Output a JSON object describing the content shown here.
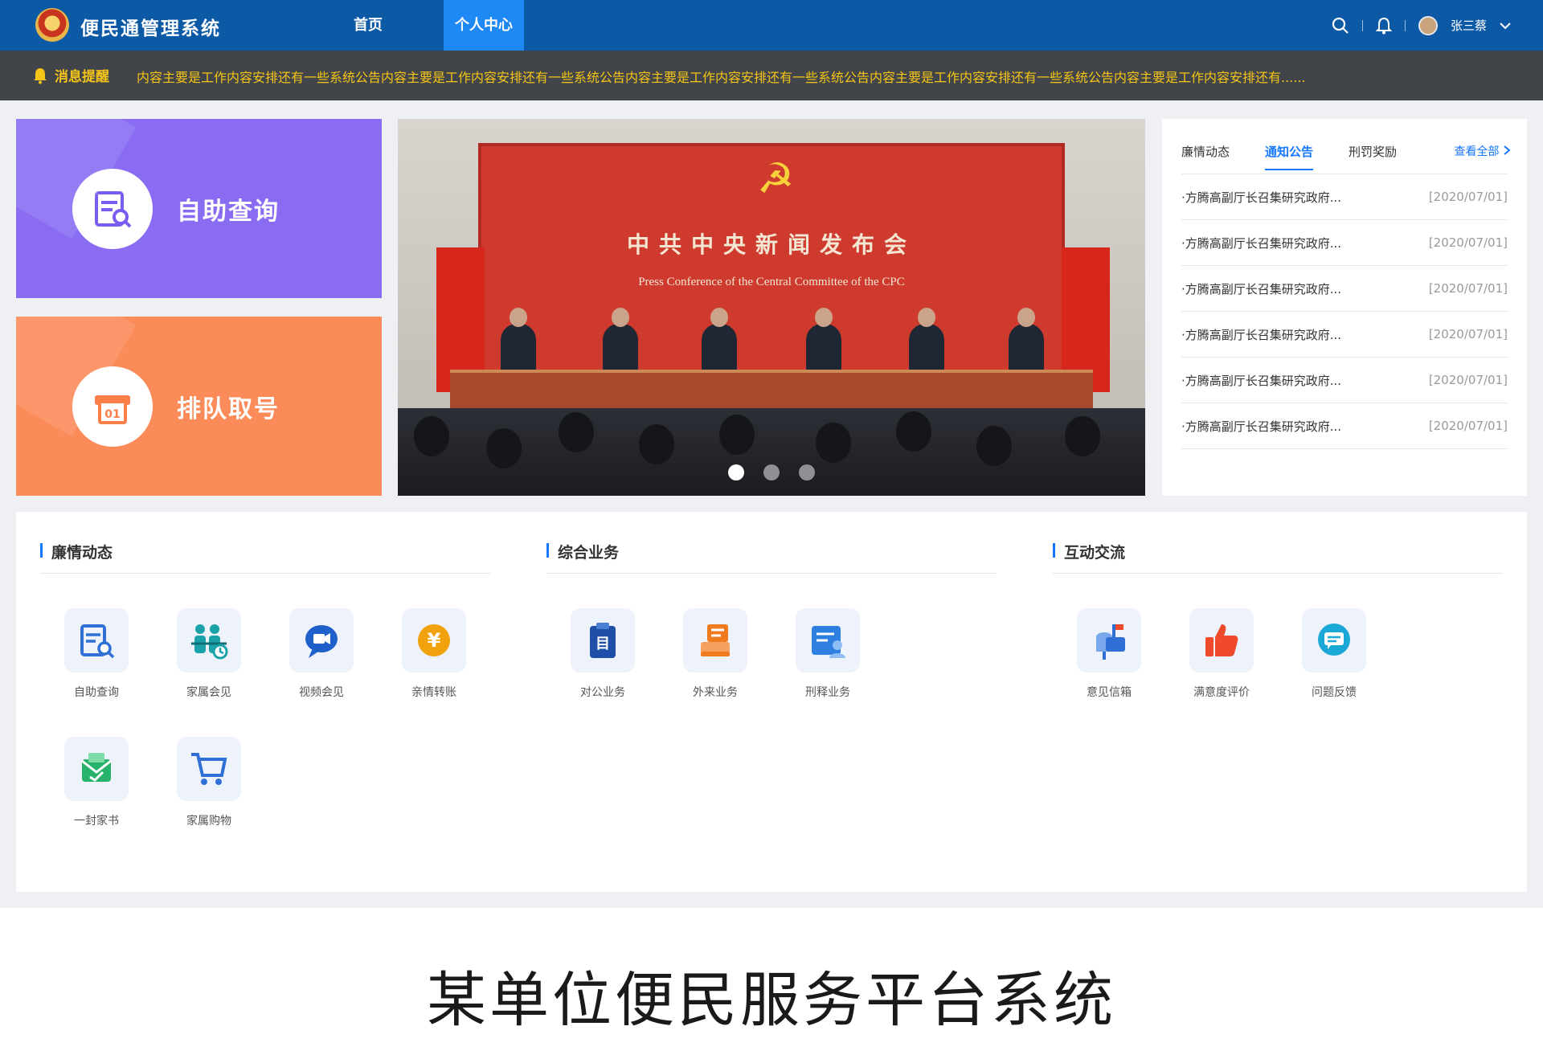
{
  "header": {
    "app_title": "便民通管理系统",
    "nav": {
      "home": "首页",
      "personal": "个人中心"
    },
    "user_name": "张三蔡"
  },
  "notice_bar": {
    "label": "消息提醒",
    "text": "内容主要是工作内容安排还有一些系统公告内容主要是工作内容安排还有一些系统公告内容主要是工作内容安排还有一些系统公告内容主要是工作内容安排还有一些系统公告内容主要是工作内容安排还有......"
  },
  "tiles": {
    "self_query": "自助查询",
    "queue": "排队取号"
  },
  "banner": {
    "title_cn": "中共中央新闻发布会",
    "title_en": "Press Conference of the Central Committee of the CPC",
    "slide_count": 3,
    "active_slide": 1
  },
  "notice_panel": {
    "tabs": [
      "廉情动态",
      "通知公告",
      "刑罚奖励"
    ],
    "active_tab": "通知公告",
    "view_all": "查看全部",
    "items": [
      {
        "title": "·方腾高副厅长召集研究政府...",
        "date": "[2020/07/01]"
      },
      {
        "title": "·方腾高副厅长召集研究政府...",
        "date": "[2020/07/01]"
      },
      {
        "title": "·方腾高副厅长召集研究政府...",
        "date": "[2020/07/01]"
      },
      {
        "title": "·方腾高副厅长召集研究政府...",
        "date": "[2020/07/01]"
      },
      {
        "title": "·方腾高副厅长召集研究政府...",
        "date": "[2020/07/01]"
      },
      {
        "title": "·方腾高副厅长召集研究政府...",
        "date": "[2020/07/01]"
      }
    ]
  },
  "services": {
    "sections": [
      {
        "title": "廉情动态",
        "items": [
          {
            "label": "自助查询",
            "icon": "document-search-icon",
            "color": "#2f6fd6"
          },
          {
            "label": "家属会见",
            "icon": "family-visit-icon",
            "color": "#1aa2a8"
          },
          {
            "label": "视频会见",
            "icon": "video-call-icon",
            "color": "#1f5fc9"
          },
          {
            "label": "亲情转账",
            "icon": "yen-transfer-icon",
            "color": "#f2a20c"
          },
          {
            "label": "一封家书",
            "icon": "letter-icon",
            "color": "#27b36b"
          },
          {
            "label": "家属购物",
            "icon": "shopping-cart-icon",
            "color": "#2f6fd6"
          }
        ]
      },
      {
        "title": "综合业务",
        "items": [
          {
            "label": "对公业务",
            "icon": "clipboard-icon",
            "color": "#1f4fa8"
          },
          {
            "label": "外来业务",
            "icon": "stamp-icon",
            "color": "#f07a1e"
          },
          {
            "label": "刑释业务",
            "icon": "id-card-icon",
            "color": "#2f7fe0"
          }
        ]
      },
      {
        "title": "互动交流",
        "items": [
          {
            "label": "意见信箱",
            "icon": "mailbox-icon",
            "color": "#2f6fd6"
          },
          {
            "label": "满意度评价",
            "icon": "thumbs-up-icon",
            "color": "#ef4a2b"
          },
          {
            "label": "问题反馈",
            "icon": "chat-bubble-icon",
            "color": "#1aa8d6"
          }
        ]
      }
    ]
  },
  "caption": "某单位便民服务平台系统",
  "colors": {
    "header": "#0c5aa6",
    "nav_active": "#1e88f5",
    "notice_bg": "#414448",
    "notice_text": "#f5c518",
    "tile_query": "#8a6cf3",
    "tile_queue": "#fb8c5a",
    "accent": "#1677ff"
  }
}
